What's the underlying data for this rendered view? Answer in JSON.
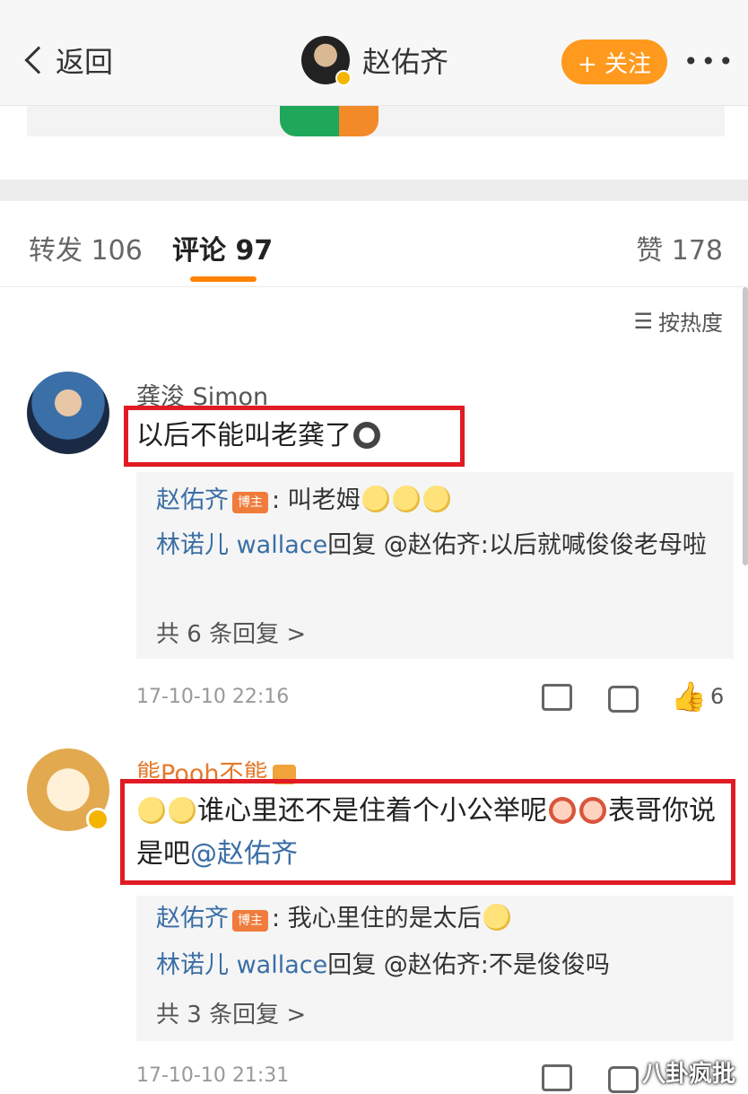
{
  "header": {
    "back_label": "返回",
    "username": "赵佑齐",
    "follow_label": "+ 关注",
    "more_label": "•••"
  },
  "tabs": {
    "repost": "转发 106",
    "comment": "评论 97",
    "like": "赞 178"
  },
  "sort_label": "按热度",
  "comments": [
    {
      "author": "龚浚 Simon",
      "text": "以后不能叫老龚了",
      "replies": [
        {
          "name": "赵佑齐",
          "badge": "博主",
          "text": ": 叫老姆"
        },
        {
          "name": "林诺儿 wallace",
          "text": "回复 @赵佑齐:以后就喊俊俊老母啦"
        }
      ],
      "more_replies": "共 6 条回复 >",
      "time": "17-10-10 22:16",
      "likes": "6"
    },
    {
      "author": "熊Pooh不熊",
      "text_a": "谁心里还不是住着个小公举呢",
      "text_b": "表哥你说是吧",
      "mention": "@赵佑齐",
      "replies": [
        {
          "name": "赵佑齐",
          "badge": "博主",
          "text": ": 我心里住的是太后"
        },
        {
          "name": "林诺儿 wallace",
          "text": "回复 @赵佑齐:不是俊俊吗"
        }
      ],
      "more_replies": "共 3 条回复 >",
      "time": "17-10-10 21:31"
    }
  ],
  "watermark": "八卦疯批",
  "colors": {
    "accent": "#ff8200",
    "follow": "#ff9a1e",
    "highlight_box": "#e01b24",
    "link": "#3a6ea5"
  }
}
